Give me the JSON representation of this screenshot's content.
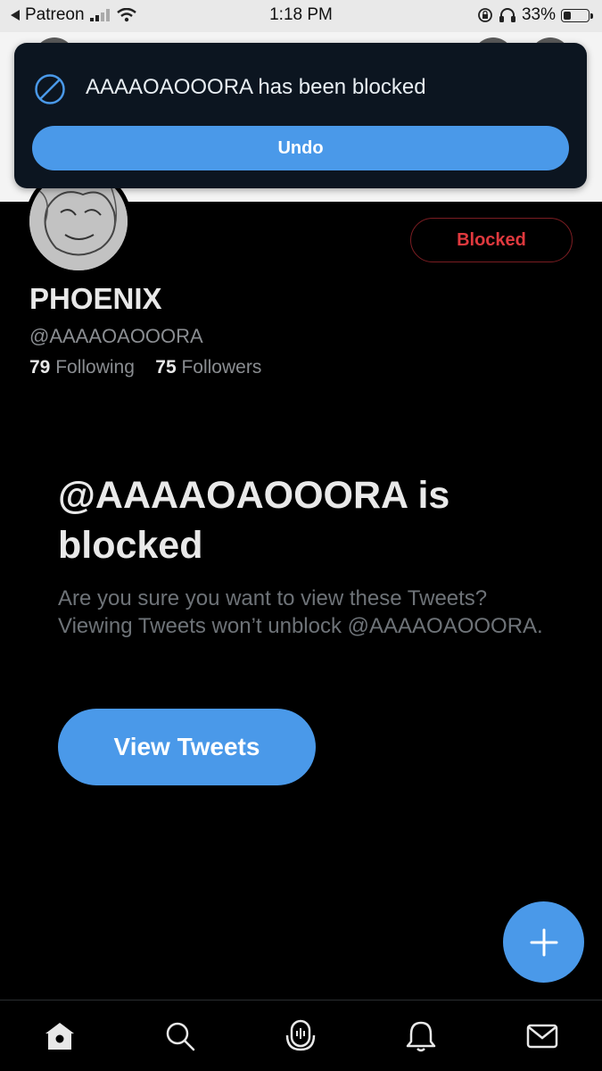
{
  "status_bar": {
    "back_app": "Patreon",
    "time": "1:18 PM",
    "battery_percent": "33%",
    "battery_level": 0.33
  },
  "toast": {
    "message": "AAAAOAOOORA has been blocked",
    "undo_label": "Undo"
  },
  "profile": {
    "blocked_label": "Blocked",
    "display_name": "PHOENIX",
    "handle": "@AAAAOAOOORA",
    "following_count": "79",
    "following_label": "Following",
    "followers_count": "75",
    "followers_label": "Followers"
  },
  "blocked_notice": {
    "title": "@AAAAOAOOORA is blocked",
    "body": "Are you sure you want to view these Tweets? Viewing Tweets won’t unblock @AAAAOAOOORA.",
    "view_button": "View Tweets"
  },
  "bottom_nav": [
    "home-icon",
    "search-icon",
    "spaces-icon",
    "notifications-icon",
    "messages-icon"
  ],
  "colors": {
    "accent": "#4a99e9",
    "blocked_red": "#e0393e",
    "background": "#000000"
  }
}
